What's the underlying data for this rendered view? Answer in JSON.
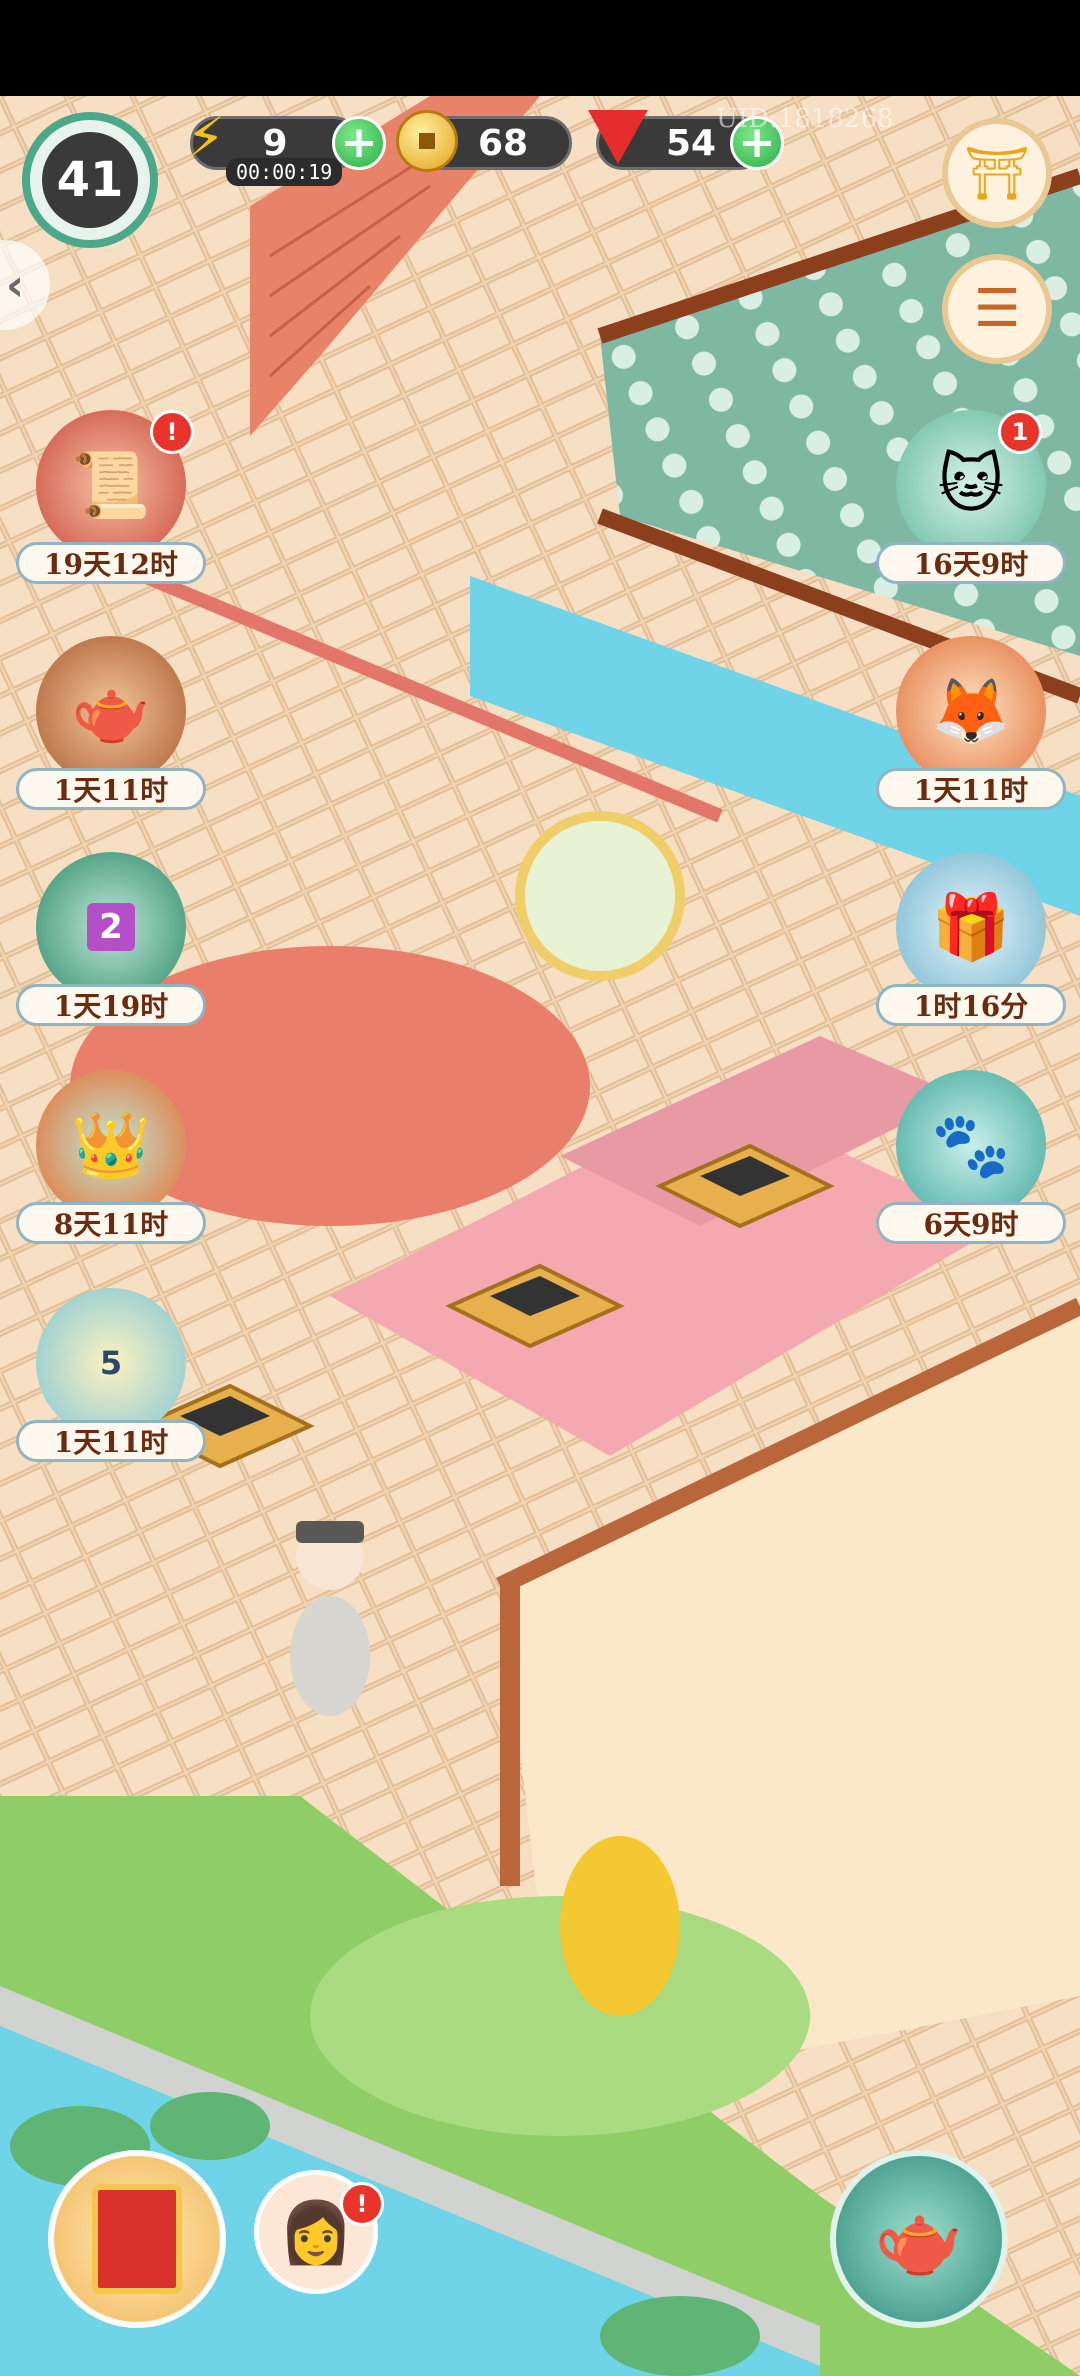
{
  "hud": {
    "level": "41",
    "energy": "9",
    "energy_timer": "00:00:19",
    "coins": "68",
    "gems": "54",
    "uid": "UID:1818268"
  },
  "left_events": [
    {
      "label": "19天12时",
      "icon": "scroll-book-icon",
      "badge": "!"
    },
    {
      "label": "1天11时",
      "icon": "tea-set-icon",
      "badge": ""
    },
    {
      "label": "1天19时",
      "icon": "treasure-shop-icon",
      "badge": "2"
    },
    {
      "label": "8天11时",
      "icon": "phoenix-crown-icon",
      "badge": ""
    },
    {
      "label": "1天11时",
      "icon": "lotus-icon",
      "badge": "5"
    }
  ],
  "right_events": [
    {
      "label": "16天9时",
      "icon": "sleeping-cat-icon",
      "badge": "1"
    },
    {
      "label": "1天11时",
      "icon": "fox-fan-icon",
      "badge": ""
    },
    {
      "label": "1时16分",
      "icon": "jade-gift-icon",
      "badge": ""
    },
    {
      "label": "6天9时",
      "icon": "cat-gift-box-icon",
      "badge": ""
    }
  ],
  "colors": {
    "accent_green": "#2fae48",
    "badge_red": "#e8342b",
    "label_text": "#6a2b10",
    "water": "#6fd4e8"
  }
}
